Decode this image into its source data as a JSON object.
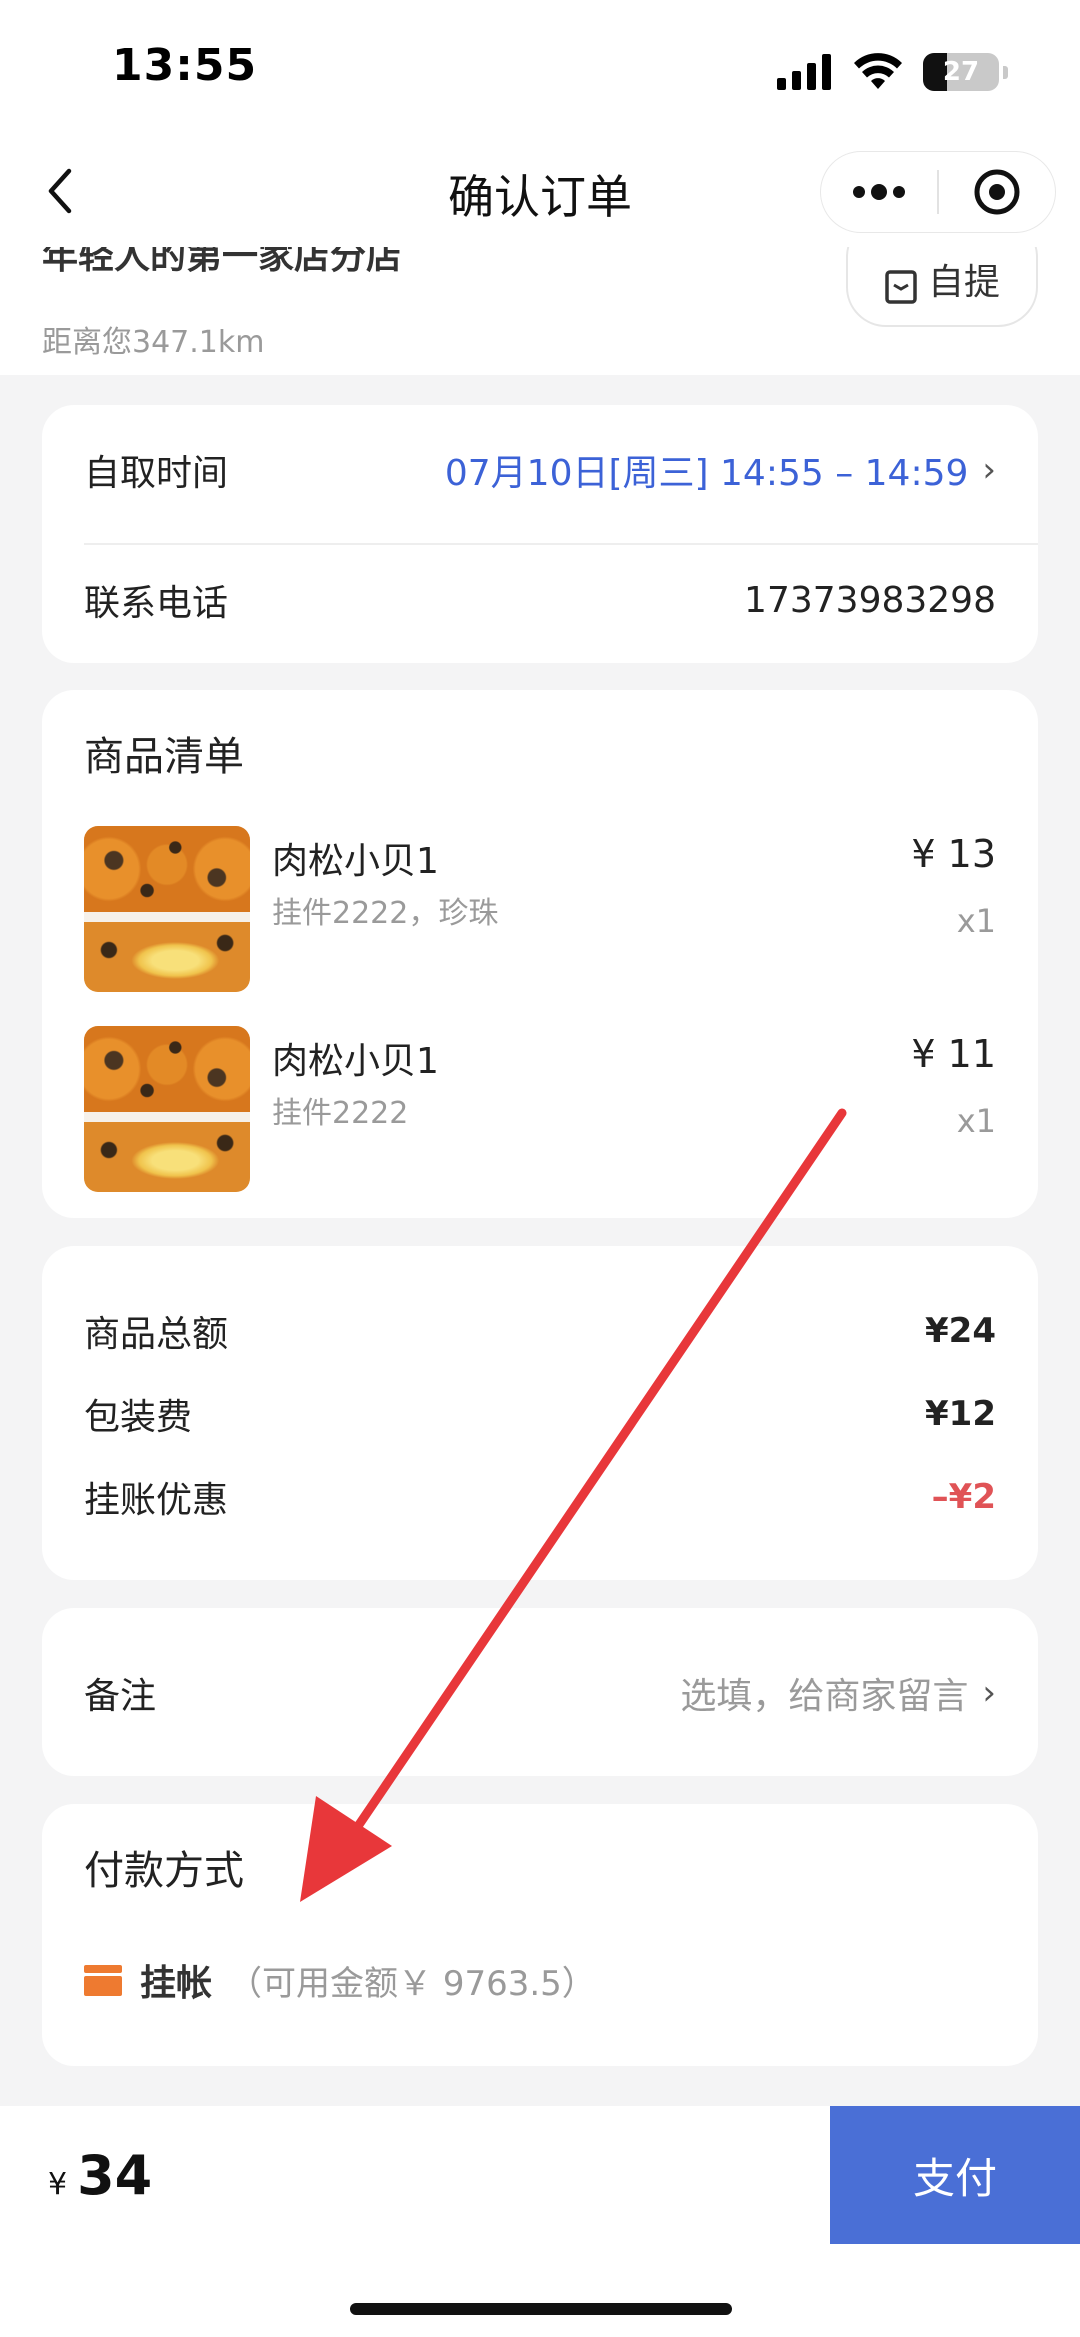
{
  "status_bar": {
    "time": "13:55",
    "battery": "27"
  },
  "nav": {
    "title": "确认订单"
  },
  "store": {
    "name": "年轻人的第一家店分店",
    "distance": "距离您347.1km",
    "pickup_label": "自提"
  },
  "pickup_card": {
    "time_label": "自取时间",
    "time_value": "07月10日[周三] 14:55 – 14:59",
    "phone_label": "联系电话",
    "phone_value": "17373983298"
  },
  "items_card": {
    "title": "商品清单",
    "items": [
      {
        "name": "肉松小贝1",
        "spec": "挂件2222，珍珠",
        "price": "¥ 13",
        "qty": "x1"
      },
      {
        "name": "肉松小贝1",
        "spec": "挂件2222",
        "price": "¥ 11",
        "qty": "x1"
      }
    ]
  },
  "summary": {
    "subtotal_label": "商品总额",
    "subtotal_value": "¥24",
    "packaging_label": "包装费",
    "packaging_value": "¥12",
    "discount_label": "挂账优惠",
    "discount_value": "–¥2"
  },
  "remark": {
    "label": "备注",
    "placeholder": "选填，给商家留言"
  },
  "payment": {
    "title": "付款方式",
    "method": "挂帐",
    "available": "（可用金额￥ 9763.5）"
  },
  "footer": {
    "currency": "¥",
    "total": "34",
    "pay_label": "支付"
  },
  "colors": {
    "accent_blue": "#4a6fd6",
    "discount_red": "#e05356",
    "pay_icon_orange": "#ee7a30",
    "annotation_arrow": "#e8373a"
  }
}
